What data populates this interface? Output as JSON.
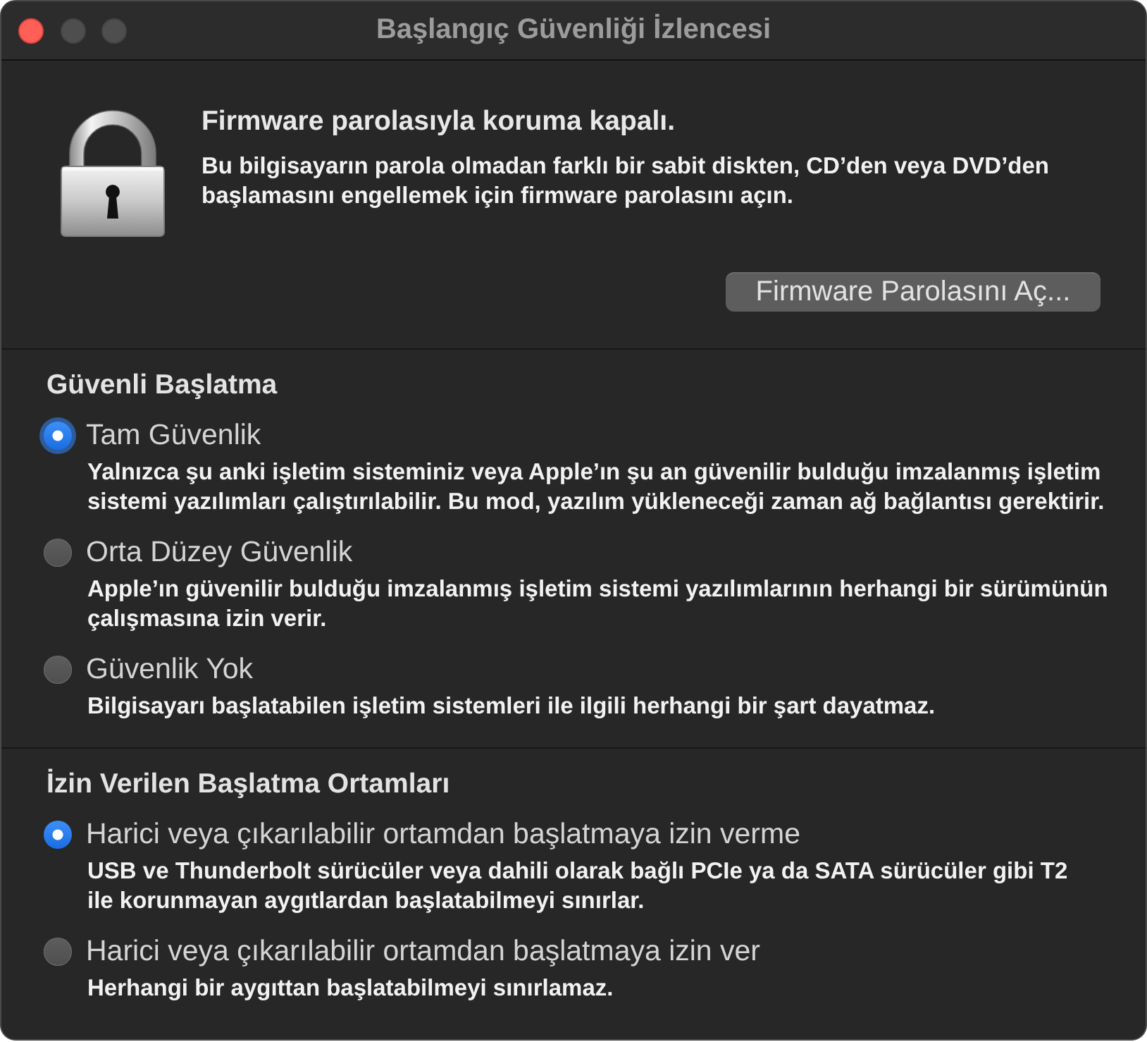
{
  "window": {
    "title": "Başlangıç Güvenliği İzlencesi",
    "buttons": [
      {
        "kind": "close",
        "disabled": false
      },
      {
        "kind": "minimize",
        "disabled": true
      },
      {
        "kind": "zoom",
        "disabled": true
      }
    ]
  },
  "firmware": {
    "heading": "Firmware parolasıyla koruma kapalı.",
    "description": "Bu bilgisayarın parola olmadan farklı bir sabit diskten, CD’den veya DVD’den\nbaşlamasını engellemek için firmware parolasını açın.",
    "button": "Firmware Parolasını Aç..."
  },
  "sections": [
    {
      "heading": "Güvenli Başlatma",
      "options": [
        {
          "label": "Tam Güvenlik",
          "description": "Yalnızca şu anki işletim sisteminiz veya Apple’ın şu an güvenilir bulduğu imzalanmış işletim\nsistemi yazılımları çalıştırılabilir. Bu mod, yazılım yükleneceği zaman ağ bağlantısı gerektirir.",
          "selected": true,
          "focused": true
        },
        {
          "label": "Orta Düzey Güvenlik",
          "description": "Apple’ın güvenilir bulduğu imzalanmış işletim sistemi yazılımlarının herhangi bir sürümünün\nçalışmasına izin verir.",
          "selected": false,
          "focused": false
        },
        {
          "label": "Güvenlik Yok",
          "description": "Bilgisayarı başlatabilen işletim sistemleri ile ilgili herhangi bir şart dayatmaz.",
          "selected": false,
          "focused": false
        }
      ]
    },
    {
      "heading": "İzin Verilen Başlatma Ortamları",
      "options": [
        {
          "label": "Harici veya çıkarılabilir ortamdan başlatmaya izin verme",
          "description": "USB ve Thunderbolt sürücüler veya dahili olarak bağlı PCIe ya da SATA sürücüler gibi T2\nile korunmayan aygıtlardan başlatabilmeyi sınırlar.",
          "selected": true,
          "focused": false
        },
        {
          "label": "Harici veya çıkarılabilir ortamdan başlatmaya izin ver",
          "description": "Herhangi bir aygıttan başlatabilmeyi sınırlamaz.",
          "selected": false,
          "focused": false
        }
      ]
    }
  ]
}
